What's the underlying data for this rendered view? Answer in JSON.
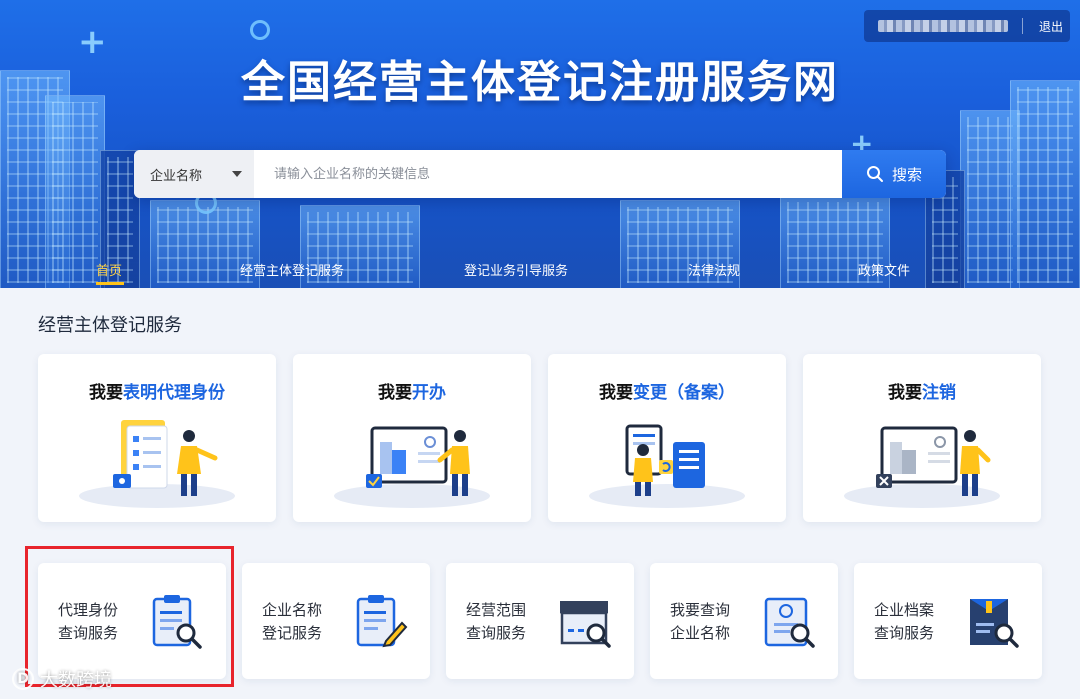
{
  "header": {
    "site_title": "全国经营主体登记注册服务网",
    "logout_label": "退出"
  },
  "search": {
    "type_label": "企业名称",
    "placeholder": "请输入企业名称的关键信息",
    "button_label": "搜索"
  },
  "nav": {
    "items": [
      {
        "label": "首页",
        "active": true
      },
      {
        "label": "经营主体登记服务",
        "active": false
      },
      {
        "label": "登记业务引导服务",
        "active": false
      },
      {
        "label": "法律法规",
        "active": false
      },
      {
        "label": "政策文件",
        "active": false
      }
    ]
  },
  "main": {
    "section_title": "经营主体登记服务",
    "big_cards": [
      {
        "prefix": "我要",
        "highlight": "表明代理身份",
        "icon": "agent-identity-illustration"
      },
      {
        "prefix": "我要",
        "highlight": "开办",
        "icon": "open-business-illustration"
      },
      {
        "prefix": "我要",
        "highlight": "变更（备案）",
        "icon": "change-filing-illustration"
      },
      {
        "prefix": "我要",
        "highlight": "注销",
        "icon": "deregister-illustration"
      }
    ],
    "small_cards": [
      {
        "line1": "代理身份",
        "line2": "查询服务",
        "icon": "clipboard-search-icon"
      },
      {
        "line1": "企业名称",
        "line2": "登记服务",
        "icon": "clipboard-pen-icon"
      },
      {
        "line1": "经营范围",
        "line2": "查询服务",
        "icon": "store-search-icon"
      },
      {
        "line1": "我要查询",
        "line2": "企业名称",
        "icon": "certificate-search-icon"
      },
      {
        "line1": "企业档案",
        "line2": "查询服务",
        "icon": "archive-search-icon"
      }
    ]
  },
  "watermark": {
    "text": "大数跨境",
    "logo_text": "D"
  },
  "colors": {
    "brand_blue": "#1d66e0",
    "active_nav": "#ffd54a",
    "highlight_red": "#e8242c"
  }
}
